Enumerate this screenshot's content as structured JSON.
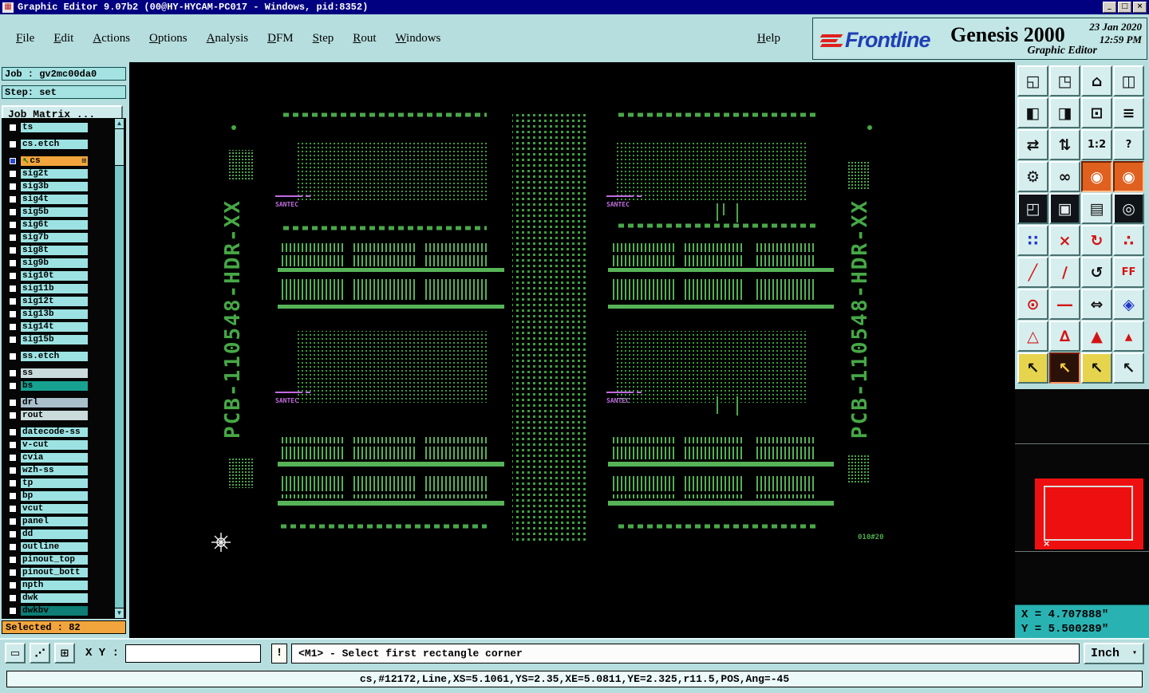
{
  "title_bar": {
    "icon_glyph": "▦",
    "title": "Graphic Editor 9.07b2 (00@HY-HYCAM-PC017 - Windows, pid:8352)",
    "buttons": [
      {
        "n": "minimize-button",
        "g": "_"
      },
      {
        "n": "maximize-button",
        "g": "□"
      },
      {
        "n": "close-button",
        "g": "×"
      }
    ]
  },
  "menu_bar": {
    "items": [
      "File",
      "Edit",
      "Actions",
      "Options",
      "Analysis",
      "DFM",
      "Step",
      "Rout",
      "Windows"
    ],
    "help": "Help"
  },
  "branding": {
    "logo": "Frontline",
    "product": "Genesis 2000",
    "date": "23 Jan 2020",
    "time": "12:59 PM",
    "subtitle": "Graphic Editor"
  },
  "job_panel": {
    "job": "Job : gv2mc00da0",
    "step": "Step: set",
    "matrix": "Job Matrix ..."
  },
  "layers": {
    "scroll_up": "▲",
    "scroll_down": "▼",
    "selected": "Selected : 82",
    "items": [
      {
        "name": "ts",
        "variant": "cyan"
      },
      {
        "name": "cs.etch",
        "variant": "cyan",
        "sep": "sep"
      },
      {
        "name": "cs",
        "variant": "selected",
        "sep": "sep",
        "cbv": "checked",
        "icon": "↖",
        "plus": "⊞"
      },
      {
        "name": "sig2t",
        "variant": "cyan"
      },
      {
        "name": "sig3b",
        "variant": "cyan"
      },
      {
        "name": "sig4t",
        "variant": "cyan"
      },
      {
        "name": "sig5b",
        "variant": "cyan"
      },
      {
        "name": "sig6t",
        "variant": "cyan"
      },
      {
        "name": "sig7b",
        "variant": "cyan"
      },
      {
        "name": "sig8t",
        "variant": "cyan"
      },
      {
        "name": "sig9b",
        "variant": "cyan"
      },
      {
        "name": "sig10t",
        "variant": "cyan"
      },
      {
        "name": "sig11b",
        "variant": "cyan"
      },
      {
        "name": "sig12t",
        "variant": "cyan"
      },
      {
        "name": "sig13b",
        "variant": "cyan"
      },
      {
        "name": "sig14t",
        "variant": "cyan"
      },
      {
        "name": "sig15b",
        "variant": "cyan"
      },
      {
        "name": "ss.etch",
        "variant": "cyan",
        "sep": "sep"
      },
      {
        "name": "ss",
        "variant": "graylight",
        "sep": "sep"
      },
      {
        "name": "bs",
        "variant": "teal"
      },
      {
        "name": "drl",
        "variant": "gray",
        "sep": "sep"
      },
      {
        "name": "rout",
        "variant": "graylight"
      },
      {
        "name": "datecode-ss",
        "variant": "cyan",
        "sep": "sep"
      },
      {
        "name": "v-cut",
        "variant": "cyan"
      },
      {
        "name": "cvia",
        "variant": "cyan"
      },
      {
        "name": "wzh-ss",
        "variant": "cyan"
      },
      {
        "name": "tp",
        "variant": "cyan"
      },
      {
        "name": "bp",
        "variant": "cyan"
      },
      {
        "name": "vcut",
        "variant": "cyan"
      },
      {
        "name": "panel",
        "variant": "cyan"
      },
      {
        "name": "dd",
        "variant": "cyan"
      },
      {
        "name": "outline",
        "variant": "cyan"
      },
      {
        "name": "pinout_top",
        "variant": "cyan"
      },
      {
        "name": "pinout_bott",
        "variant": "cyan"
      },
      {
        "name": "npth",
        "variant": "cyan"
      },
      {
        "name": "dwk",
        "variant": "cyan"
      },
      {
        "name": "dwkbv",
        "variant": "darkteal"
      }
    ]
  },
  "canvas": {
    "pcb_label": "PCB-110548-HDR-XX",
    "mark_text": "SANTEC",
    "corner_text": "010#20"
  },
  "toolbar": {
    "icons": [
      {
        "n": "screen-copy-icon",
        "g": "◱"
      },
      {
        "n": "screen-paste-icon",
        "g": "◳"
      },
      {
        "n": "home-view-icon",
        "g": "⌂"
      },
      {
        "n": "tile-windows-icon",
        "g": "◫"
      },
      {
        "n": "zoom-in-icon",
        "g": "◧"
      },
      {
        "n": "zoom-out-icon",
        "g": "◨"
      },
      {
        "n": "previous-view-icon",
        "g": "⊡"
      },
      {
        "n": "layer-list-icon",
        "g": "≡"
      },
      {
        "n": "flip-horizontal-icon",
        "g": "⇄"
      },
      {
        "n": "flip-vertical-icon",
        "g": "⇅"
      },
      {
        "n": "zoom-ratio-icon",
        "g": "1:2",
        "v": "txt"
      },
      {
        "n": "help-icon",
        "g": "?",
        "v": "txt"
      },
      {
        "n": "settings-icon",
        "g": "⚙"
      },
      {
        "n": "measure-icon",
        "g": "∞"
      },
      {
        "n": "highlight-selected-icon",
        "g": "◉",
        "v": "sel"
      },
      {
        "n": "highlight-net-icon",
        "g": "◉",
        "v": "sel"
      },
      {
        "n": "origin-corner-icon",
        "g": "◰",
        "v": "dark"
      },
      {
        "n": "pad-shape-icon",
        "g": "▣",
        "v": "dark"
      },
      {
        "n": "ruler-icon",
        "g": "▤"
      },
      {
        "n": "target-circle-icon",
        "g": "◎",
        "v": "dark"
      },
      {
        "n": "net-points-icon",
        "g": "∷",
        "v": "blue"
      },
      {
        "n": "delete-icon",
        "g": "×",
        "v": "red"
      },
      {
        "n": "rotate-cw-icon",
        "g": "↻",
        "v": "red"
      },
      {
        "n": "scatter-points-icon",
        "g": "∴",
        "v": "red"
      },
      {
        "n": "line-diagonal-icon",
        "g": "╱",
        "v": "red"
      },
      {
        "n": "line-thin-icon",
        "g": "∕",
        "v": "red"
      },
      {
        "n": "rotate-ccw-icon",
        "g": "↺"
      },
      {
        "n": "font-ff-icon",
        "g": "FF",
        "v": "redtxt"
      },
      {
        "n": "pad-center-icon",
        "g": "⊙",
        "v": "red"
      },
      {
        "n": "dash-line-icon",
        "g": "―",
        "v": "red"
      },
      {
        "n": "stretch-icon",
        "g": "⇔"
      },
      {
        "n": "copy-block-icon",
        "g": "◈",
        "v": "blue"
      },
      {
        "n": "triangle-outline-icon",
        "g": "△",
        "v": "red"
      },
      {
        "n": "triangle-slash-icon",
        "g": "∆",
        "v": "red"
      },
      {
        "n": "triangle-filled-icon",
        "g": "▲",
        "v": "red"
      },
      {
        "n": "triangle-small-icon",
        "g": "▴",
        "v": "red"
      },
      {
        "n": "cursor-select-icon",
        "g": "↖",
        "v": "yellow"
      },
      {
        "n": "cursor-active-icon",
        "g": "↖",
        "v": "seldark"
      },
      {
        "n": "cursor-query-icon",
        "g": "↖",
        "v": "yellow"
      },
      {
        "n": "cursor-snap-icon",
        "g": "↖"
      }
    ]
  },
  "overview": {
    "marker": "×"
  },
  "coords": {
    "x": "X = 4.707888\"",
    "y": "Y = 5.500289\""
  },
  "command_bar": {
    "tools": [
      {
        "n": "window-tool-button",
        "g": "▭"
      },
      {
        "n": "probe-tool-button",
        "g": "⋰"
      },
      {
        "n": "grid-tool-button",
        "g": "⊞"
      }
    ],
    "xy_label": "X Y :",
    "xy_value": "",
    "bang": "!",
    "prompt": "<M1> - Select first rectangle corner",
    "units": "Inch",
    "units_caret": "▾"
  },
  "status_bar": {
    "text": "cs,#12172,Line,XS=5.1061,YS=2.35,XE=5.0811,YE=2.325,r11.5,POS,Ang=-45"
  }
}
